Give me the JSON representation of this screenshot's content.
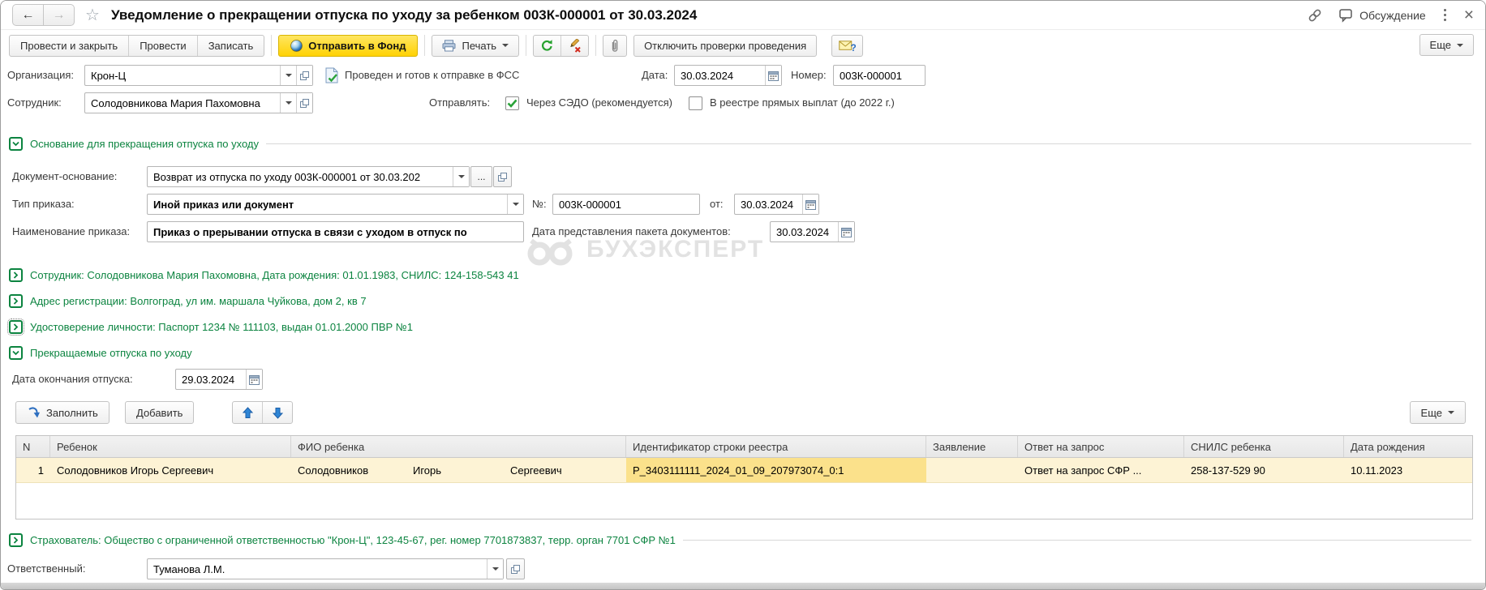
{
  "titlebar": {
    "title": "Уведомление о прекращении отпуска по уходу за ребенком 003К-000001 от 30.03.2024",
    "discussion": "Обсуждение"
  },
  "toolbar": {
    "post_and_close": "Провести и закрыть",
    "post": "Провести",
    "save": "Записать",
    "send_to_fund": "Отправить в Фонд",
    "print": "Печать",
    "disable_checks": "Отключить проверки проведения",
    "more": "Еще"
  },
  "header": {
    "org_label": "Организация:",
    "org_value": "Крон-Ц",
    "status": "Проведен и готов к отправке в ФСС",
    "date_label": "Дата:",
    "date_value": "30.03.2024",
    "number_label": "Номер:",
    "number_value": "003К-000001",
    "employee_label": "Сотрудник:",
    "employee_value": "Солодовникова Мария Пахомовна",
    "send_mode_label": "Отправлять:",
    "sedo_option": "Через СЭДО (рекомендуется)",
    "registry_option": "В реестре прямых выплат (до 2022 г.)"
  },
  "basis": {
    "section_title": "Основание для прекращения отпуска по уходу",
    "doc_label": "Документ-основание:",
    "doc_value": "Возврат из отпуска по уходу 003К-000001 от 30.03.202",
    "ellipsis": "...",
    "order_type_label": "Тип приказа:",
    "order_type_value": "Иной приказ или документ",
    "order_no_label": "№:",
    "order_no_value": "003К-000001",
    "order_from_label": "от:",
    "order_date": "30.03.2024",
    "order_name_label": "Наименование приказа:",
    "order_name_value": "Приказ о прерывании отпуска в связи с уходом в отпуск по",
    "package_date_label": "Дата представления пакета документов:",
    "package_date": "30.03.2024"
  },
  "person_sections": {
    "employee": "Сотрудник: Солодовникова Мария Пахомовна, Дата рождения: 01.01.1983, СНИЛС: 124-158-543 41",
    "address": "Адрес регистрации: Волгоград, ул им. маршала Чуйкова, дом 2, кв 7",
    "identity": "Удостоверение личности: Паспорт 1234 № 111103, выдан 01.01.2000 ПВР №1"
  },
  "leaves": {
    "section_title": "Прекращаемые отпуска по уходу",
    "end_date_label": "Дата окончания отпуска:",
    "end_date_value": "29.03.2024",
    "fill": "Заполнить",
    "add": "Добавить",
    "more": "Еще"
  },
  "table": {
    "headers": [
      "N",
      "Ребенок",
      "ФИО ребенка",
      "Идентификатор строки реестра",
      "Заявление",
      "Ответ на запрос",
      "СНИЛС ребенка",
      "Дата рождения"
    ],
    "row": {
      "num": "1",
      "child": "Солодовников Игорь Сергеевич",
      "last_name": "Солодовников",
      "first_name": "Игорь",
      "middle_name": "Сергеевич",
      "registry_id": "Р_3403111111_2024_01_09_207973074_0:1",
      "application": "",
      "response": "Ответ на запрос СФР ...",
      "snils": "258-137-529 90",
      "birth_date": "10.11.2023"
    }
  },
  "footer": {
    "insurer": "Страхователь: Общество с ограниченной ответственностью \"Крон-Ц\", 123-45-67, рег. номер 7701873837, терр. орган 7701 СФР №1",
    "responsible_label": "Ответственный:",
    "responsible_value": "Туманова Л.М."
  },
  "watermark": "БУХЭКСПЕРТ",
  "colors": {
    "green": "#0c8440",
    "accent_yellow": "#ffd204",
    "selected_row": "#fdf3d5",
    "active_cell": "#fbe18b"
  }
}
